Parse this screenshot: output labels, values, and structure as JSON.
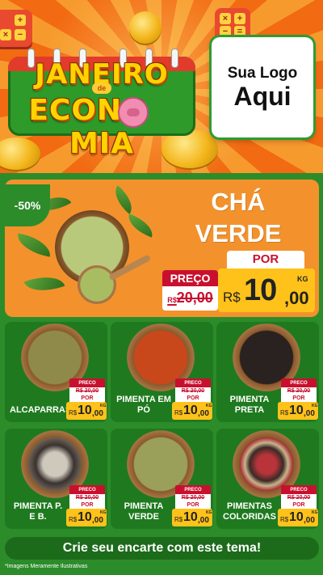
{
  "brand_title": {
    "line1": "JANEIRO",
    "connector": "de",
    "line2a": "ECONO",
    "line2b": "MIA"
  },
  "logo": {
    "line1": "Sua Logo",
    "line2": "Aqui"
  },
  "featured": {
    "discount": "-50%",
    "name_line1": "CHÁ",
    "name_line2": "VERDE",
    "por_label": "POR",
    "preco_label": "PREÇO",
    "old_currency": "R$",
    "old_value": "20,00",
    "currency": "R$",
    "price_int": "10",
    "price_cents": ",00",
    "unit": "KG"
  },
  "products": [
    {
      "name": "ALCAPARRAS",
      "preco": "PRECO",
      "old": "R$ 20,00",
      "por": "POR",
      "cur": "R$",
      "int": "10",
      "cents": ",00",
      "unit": "KG"
    },
    {
      "name": "PIMENTA EM PÓ",
      "preco": "PRECO",
      "old": "R$ 20,00",
      "por": "POR",
      "cur": "R$",
      "int": "10",
      "cents": ",00",
      "unit": "KG"
    },
    {
      "name": "PIMENTA PRETA",
      "preco": "PRECO",
      "old": "R$ 20,00",
      "por": "POR",
      "cur": "R$",
      "int": "10",
      "cents": ",00",
      "unit": "KG"
    },
    {
      "name": "PIMENTA P. E B.",
      "preco": "PRECO",
      "old": "R$ 20,00",
      "por": "POR",
      "cur": "R$",
      "int": "10",
      "cents": ",00",
      "unit": "KG"
    },
    {
      "name": "PIMENTA VERDE",
      "preco": "PRECO",
      "old": "R$ 20,00",
      "por": "POR",
      "cur": "R$",
      "int": "10",
      "cents": ",00",
      "unit": "KG"
    },
    {
      "name": "PIMENTAS COLORIDAS",
      "preco": "PRECO",
      "old": "R$ 20,00",
      "por": "POR",
      "cur": "R$",
      "int": "10",
      "cents": ",00",
      "unit": "KG"
    }
  ],
  "cta": "Crie seu encarte com este tema!",
  "footer_note": "*Imagens Meramente Ilustrativas",
  "colors": {
    "orange": "#f3922c",
    "green": "#2c8c2a",
    "dark_green": "#1f7a1f",
    "red": "#c8102e",
    "yellow": "#ffc21a"
  }
}
